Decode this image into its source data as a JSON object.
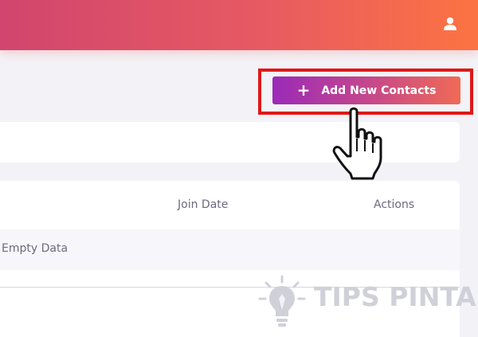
{
  "header": {
    "user_icon": "user-icon",
    "gradient_colors": [
      "#d1456e",
      "#fc7342"
    ]
  },
  "toolbar": {
    "add_button_icon": "+",
    "add_button_label": "Add New Contacts",
    "highlight_color": "#e01818"
  },
  "table": {
    "columns": [
      "Join Date",
      "Actions"
    ],
    "empty_text": "Empty Data"
  },
  "watermark": {
    "text": "TIPS PINTAR",
    "icon": "lightbulb-icon"
  },
  "cursor": {
    "icon": "hand-pointer-icon"
  }
}
